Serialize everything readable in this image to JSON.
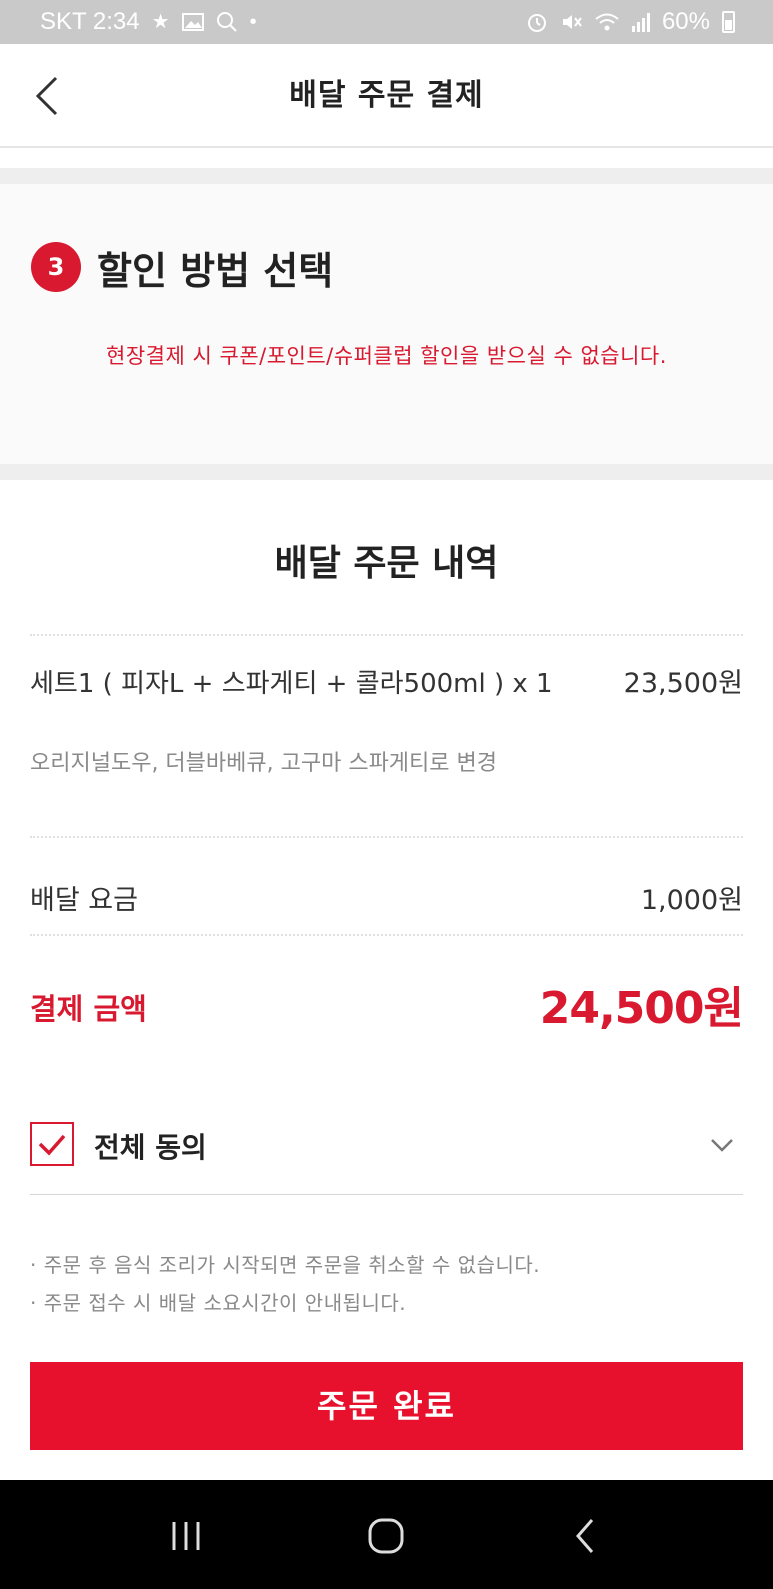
{
  "status_bar": {
    "carrier_time": "SKT 2:34",
    "battery": "60%",
    "left_icons": [
      "star-icon",
      "image-icon",
      "search-icon",
      "dot-icon"
    ],
    "right_icons": [
      "alarm-icon",
      "mute-icon",
      "wifi-icon",
      "signal-icon",
      "battery-icon"
    ]
  },
  "header": {
    "title": "배달 주문 결제",
    "back_icon": "chevron-left-icon"
  },
  "discount": {
    "step_number": "3",
    "title": "할인 방법 선택",
    "notice": "현장결제 시 쿠폰/포인트/슈퍼클럽 할인을 받으실 수 없습니다."
  },
  "order": {
    "title": "배달 주문 내역",
    "item": {
      "name": "세트1 ( 피자L + 스파게티 + 콜라500ml ) x 1",
      "price": "23,500원",
      "options": "오리지널도우, 더블바베큐, 고구마 스파게티로 변경"
    },
    "delivery_fee_label": "배달 요금",
    "delivery_fee": "1,000원",
    "total_label": "결제 금액",
    "total": "24,500원"
  },
  "agree": {
    "label": "전체 동의",
    "checked": true
  },
  "notes": [
    "· 주문 후 음식 조리가 시작되면 주문을 취소할 수 없습니다.",
    "· 주문 접수 시 배달 소요시간이 안내됩니다."
  ],
  "complete_button": "주문 완료",
  "nav": {
    "icons": [
      "recent-apps-icon",
      "home-icon",
      "back-icon"
    ]
  },
  "colors": {
    "accent": "#e8112d",
    "badge": "#d8192f",
    "status_bar": "#c9c9c9",
    "nav_bar": "#000000"
  }
}
